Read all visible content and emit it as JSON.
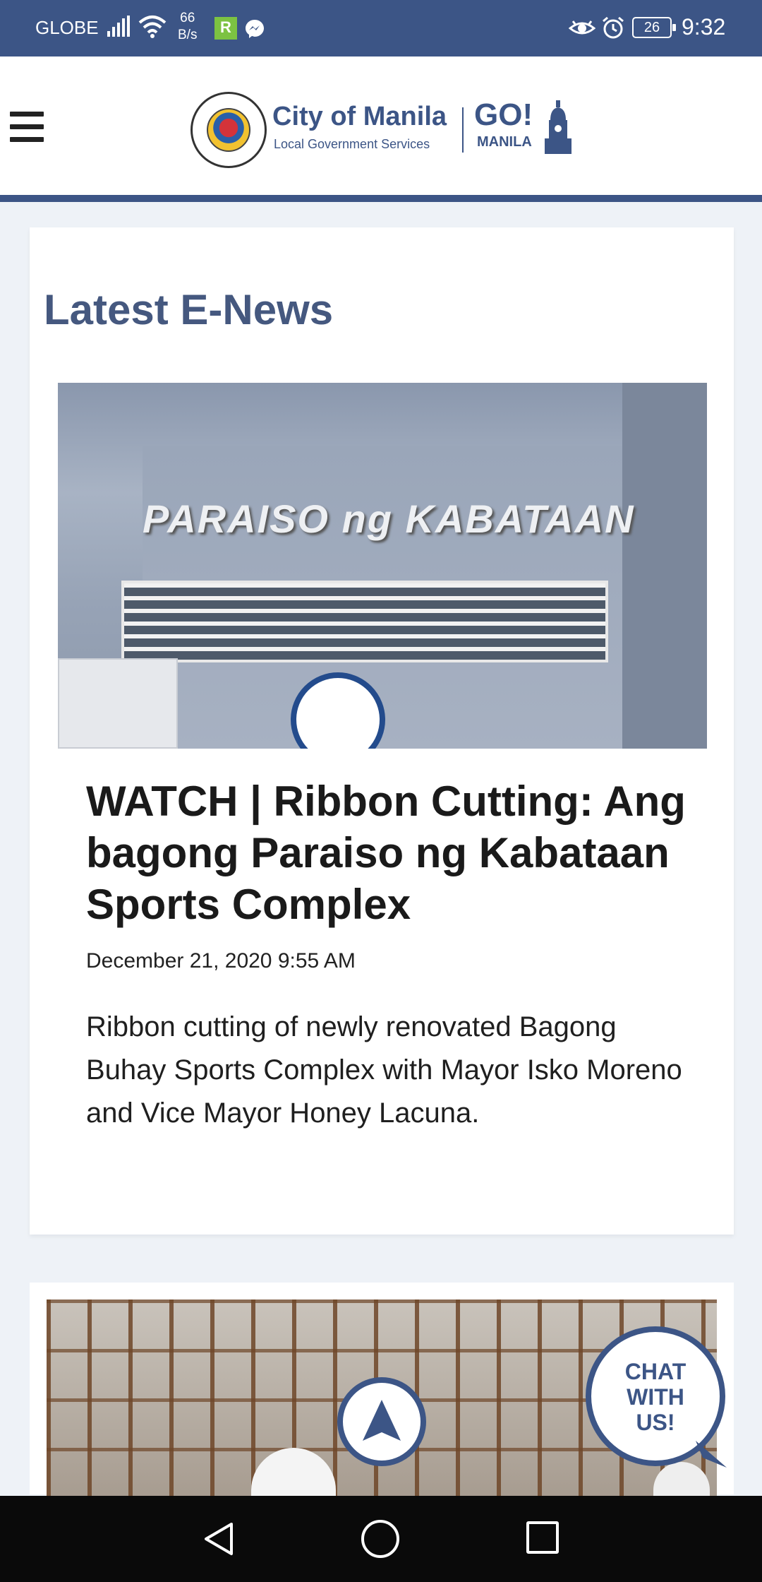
{
  "status_bar": {
    "carrier": "GLOBE",
    "speed_value": "66",
    "speed_unit": "B/s",
    "app_badge": "R",
    "battery": "26",
    "time": "9:32"
  },
  "header": {
    "seal_text": "LUNGSOD NG MAYNILA · PILIPINAS",
    "brand_title": "City of Manila",
    "brand_subtitle": "Local Government Services",
    "go_text": "GO!",
    "go_subtitle": "MANILA"
  },
  "main": {
    "section_title": "Latest E-News",
    "articles": [
      {
        "image_sign": "PARAISO ng KABATAAN",
        "headline": "WATCH | Ribbon Cutting: Ang bagong Paraiso ng Kabataan Sports Complex",
        "date": "December 21, 2020 9:55 AM",
        "excerpt": "Ribbon cutting of newly renovated Bagong Buhay Sports Complex with Mayor Isko Moreno and Vice Mayor Honey Lacuna."
      }
    ]
  },
  "floating": {
    "chat_line1": "CHAT",
    "chat_line2": "WITH",
    "chat_line3": "US!"
  },
  "colors": {
    "primary": "#3c5586",
    "section_title": "#45587f",
    "background": "#eef2f7"
  },
  "icons": {
    "menu": "hamburger-icon",
    "scroll_top": "arrow-up-icon",
    "back": "back-triangle-icon",
    "home": "home-circle-icon",
    "recent": "recent-apps-icon"
  }
}
